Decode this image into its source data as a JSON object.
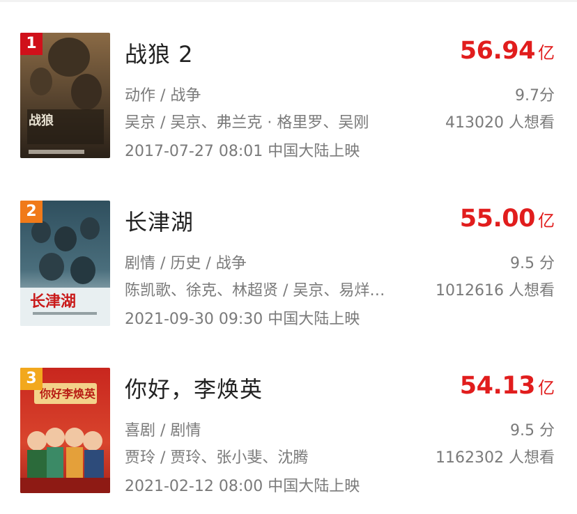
{
  "colors": {
    "price": "#e11d1d",
    "rank1": "#d0101a",
    "rank2": "#f07a19",
    "rank3": "#f2a81d"
  },
  "movies": [
    {
      "rank": "1",
      "title": "战狼 2",
      "box_value": "56.94",
      "box_unit": "亿",
      "genre": "动作 / 战争",
      "score": "9.7分",
      "cast": "吴京 / 吴京、弗兰克 · 格里罗、吴刚",
      "want": "413020 人想看",
      "date": "2017-07-27 08:01 中国大陆上映"
    },
    {
      "rank": "2",
      "title": "长津湖",
      "box_value": "55.00",
      "box_unit": "亿",
      "genre": "剧情 / 历史 / 战争",
      "score": "9.5 分",
      "cast": "陈凯歌、徐克、林超贤 / 吴京、易烊…",
      "want": "1012616 人想看",
      "date": "2021-09-30 09:30 中国大陆上映"
    },
    {
      "rank": "3",
      "title": "你好，李焕英",
      "box_value": "54.13",
      "box_unit": "亿",
      "genre": "喜剧 / 剧情",
      "score": "9.5 分",
      "cast": "贾玲 / 贾玲、张小斐、沈腾",
      "want": "1162302 人想看",
      "date": "2021-02-12 08:00 中国大陆上映"
    }
  ]
}
